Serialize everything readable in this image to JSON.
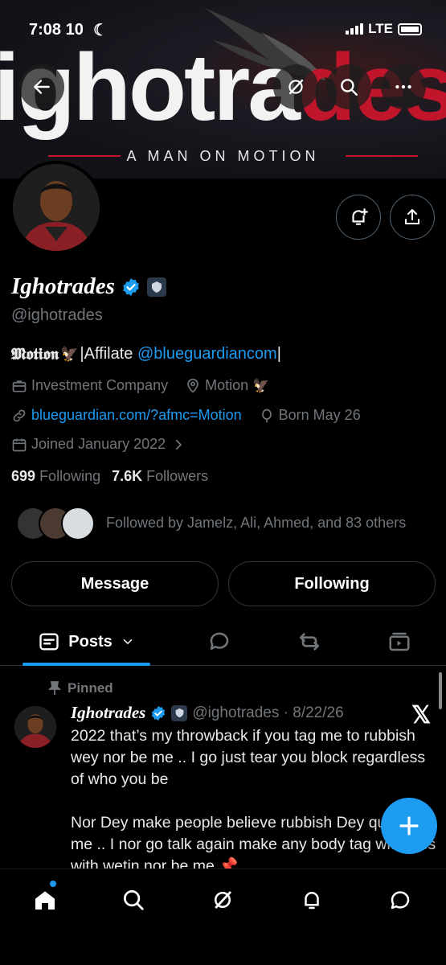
{
  "status_bar": {
    "time": "7:08 10",
    "network": "LTE"
  },
  "banner": {
    "wordmark_main": "ighotra",
    "wordmark_accent": "des",
    "tagline": "A MAN ON MOTION"
  },
  "profile": {
    "name": "Ighotrades",
    "handle": "@ighotrades",
    "bio_styled": "𝕸𝖔𝖙𝖎𝖔𝖓",
    "bio_text": "|Affilate ",
    "bio_mention": "@blueguardiancom",
    "bio_tail": "|",
    "category": "Investment Company",
    "location": "Motion",
    "website": "blueguardian.com/?afmc=Motion",
    "birthday": "Born May 26",
    "joined": "Joined January 2022",
    "following_count": "699",
    "following_label": "Following",
    "followers_count": "7.6K",
    "followers_label": "Followers",
    "followed_by": "Followed by Jamelz, Ali, Ahmed, and 83 others"
  },
  "buttons": {
    "message": "Message",
    "following": "Following"
  },
  "tabs": {
    "posts": "Posts"
  },
  "post": {
    "pinned_label": "Pinned",
    "author": "Ighotrades",
    "handle_date": "@ighotrades · 8/22/26",
    "paragraph1": "2022 that’s my throwback if you tag me to rubbish wey nor be me .. I go just tear you block regardless of who you be",
    "paragraph2": "Nor Dey make people believe rubbish Dey question me .. I nor go talk again make any body tag with pics with wetin nor be me 📌"
  },
  "colors": {
    "accent": "#1d9bf0",
    "brand_red": "#c0152a",
    "muted": "#71767b"
  }
}
